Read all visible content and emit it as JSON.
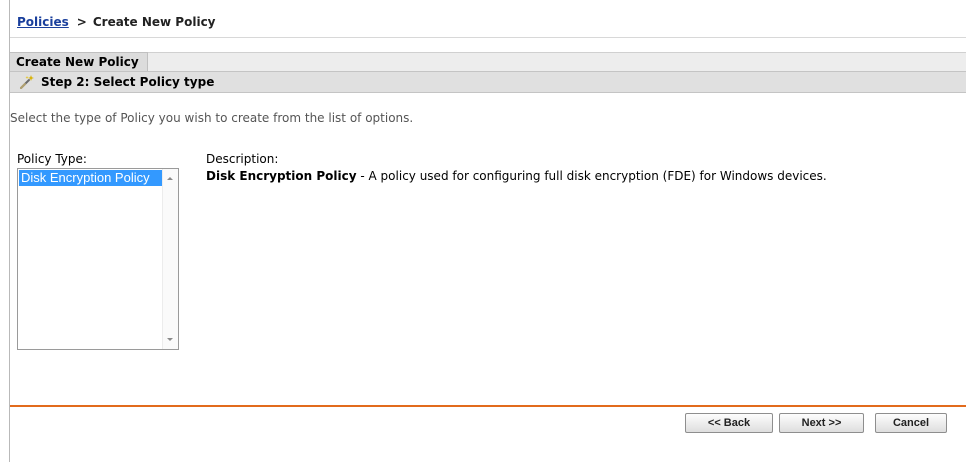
{
  "breadcrumb": {
    "link": "Policies",
    "separator": ">",
    "current": "Create New Policy"
  },
  "wizard": {
    "tab_label": "Create New Policy",
    "step_title": "Step 2: Select Policy type",
    "step_icon": "magic-wand-icon"
  },
  "instructions": "Select the type of Policy you wish to create from the list of options.",
  "policy_type": {
    "label": "Policy Type:",
    "options": [
      "Disk Encryption Policy"
    ],
    "selected": "Disk Encryption Policy"
  },
  "description": {
    "label": "Description:",
    "name": "Disk Encryption Policy",
    "text": " - A policy used for configuring full disk encryption (FDE) for Windows devices."
  },
  "buttons": {
    "back": "<< Back",
    "next": "Next >>",
    "cancel": "Cancel"
  },
  "colors": {
    "accent_rule": "#e26b1c",
    "selection": "#3399ff",
    "link": "#1a3f9c"
  }
}
